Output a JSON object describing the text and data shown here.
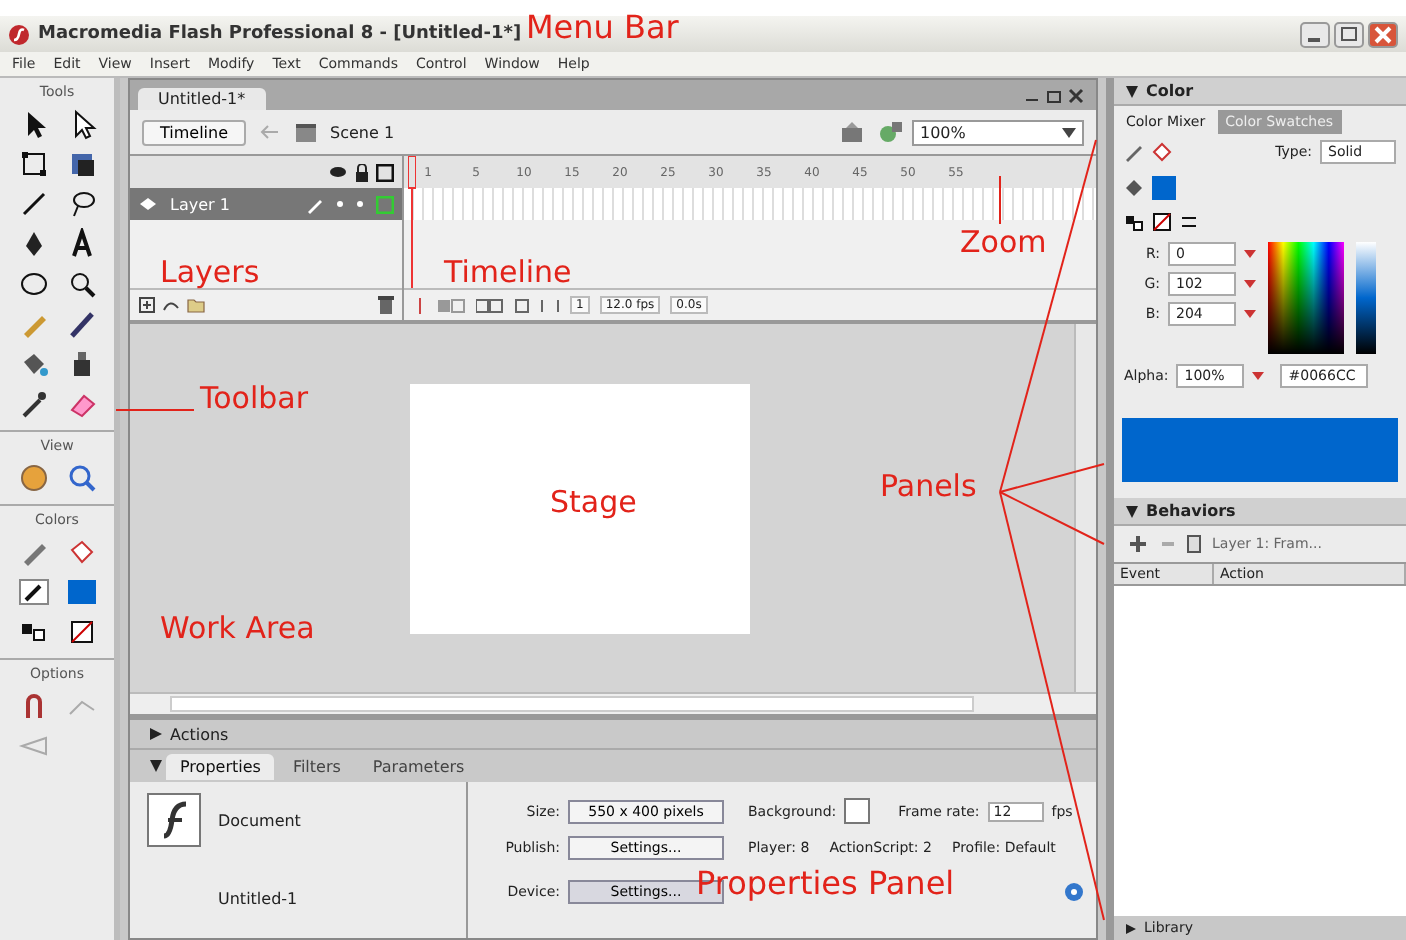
{
  "window": {
    "title": "Macromedia Flash Professional 8 - [Untitled-1*]"
  },
  "menu": [
    "File",
    "Edit",
    "View",
    "Insert",
    "Modify",
    "Text",
    "Commands",
    "Control",
    "Window",
    "Help"
  ],
  "tools": {
    "sections": [
      {
        "title": "Tools"
      },
      {
        "title": "View"
      },
      {
        "title": "Colors"
      },
      {
        "title": "Options"
      }
    ]
  },
  "document": {
    "tab": "Untitled-1*",
    "timeline_button": "Timeline",
    "scene": "Scene 1",
    "zoom": "100%",
    "layer": "Layer 1",
    "frame_numbers": [
      "1",
      "5",
      "10",
      "15",
      "20",
      "25",
      "30",
      "35",
      "40",
      "45",
      "50",
      "55"
    ],
    "current_frame": "1",
    "frame_rate": "12.0 fps",
    "elapsed": "0.0s"
  },
  "properties": {
    "actions_title": "Actions",
    "tabs": [
      {
        "label": "Properties",
        "selected": true
      },
      {
        "label": "Filters",
        "selected": false
      },
      {
        "label": "Parameters",
        "selected": false
      }
    ],
    "doc_label": "Document",
    "doc_name": "Untitled-1",
    "size_label": "Size:",
    "size_button": "550 x 400 pixels",
    "background_label": "Background:",
    "frame_rate_label": "Frame rate:",
    "frame_rate": "12",
    "fps": "fps",
    "publish_label": "Publish:",
    "publish_button": "Settings...",
    "player": "Player: 8",
    "actionscript": "ActionScript: 2",
    "profile": "Profile: Default",
    "device_label": "Device:",
    "device_button": "Settings..."
  },
  "color_panel": {
    "title": "Color",
    "tabs": [
      {
        "label": "Color Mixer",
        "selected": true
      },
      {
        "label": "Color Swatches",
        "selected": false
      }
    ],
    "type_label": "Type:",
    "type": "Solid",
    "channels": [
      {
        "label": "R:",
        "value": "0"
      },
      {
        "label": "G:",
        "value": "102"
      },
      {
        "label": "B:",
        "value": "204"
      }
    ],
    "alpha_label": "Alpha:",
    "alpha": "100%",
    "hex": "#0066CC",
    "color": "#0066cc"
  },
  "behaviors_panel": {
    "title": "Behaviors",
    "target": "Layer 1: Fram...",
    "columns": [
      "Event",
      "Action"
    ]
  },
  "library_panel": {
    "title": "Library"
  },
  "annotations": [
    {
      "text": "Menu Bar"
    },
    {
      "text": "Layers"
    },
    {
      "text": "Timeline"
    },
    {
      "text": "Zoom"
    },
    {
      "text": "Toolbar"
    },
    {
      "text": "Stage"
    },
    {
      "text": "Panels"
    },
    {
      "text": "Work Area"
    },
    {
      "text": "Properties Panel"
    }
  ]
}
